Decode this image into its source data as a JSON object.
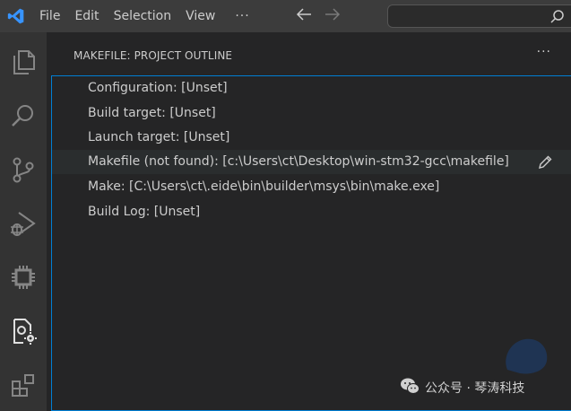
{
  "menu": {
    "items": [
      "File",
      "Edit",
      "Selection",
      "View"
    ],
    "more": "···"
  },
  "search": {
    "placeholder": ""
  },
  "activity_bar": {
    "icons": [
      "explorer-icon",
      "search-icon",
      "source-control-icon",
      "run-debug-icon",
      "chip-icon",
      "makefile-tools-icon",
      "extensions-icon"
    ]
  },
  "panel": {
    "title": "MAKEFILE: PROJECT OUTLINE",
    "more": "···",
    "rows": [
      "Configuration: [Unset]",
      "Build target: [Unset]",
      "Launch target: [Unset]",
      "Makefile (not found): [c:\\Users\\ct\\Desktop\\win-stm32-gcc\\makefile]",
      "Make: [C:\\Users\\ct\\.eide\\bin\\builder\\msys\\bin\\make.exe]",
      "Build Log: [Unset]"
    ]
  },
  "watermark": {
    "text": "公众号 · 琴涛科技"
  },
  "colors": {
    "accent": "#007fd4",
    "vscode_blue": "#3794ff",
    "titlebar": "#3c3c3c",
    "activity_bar": "#333333",
    "panel": "#252526"
  }
}
